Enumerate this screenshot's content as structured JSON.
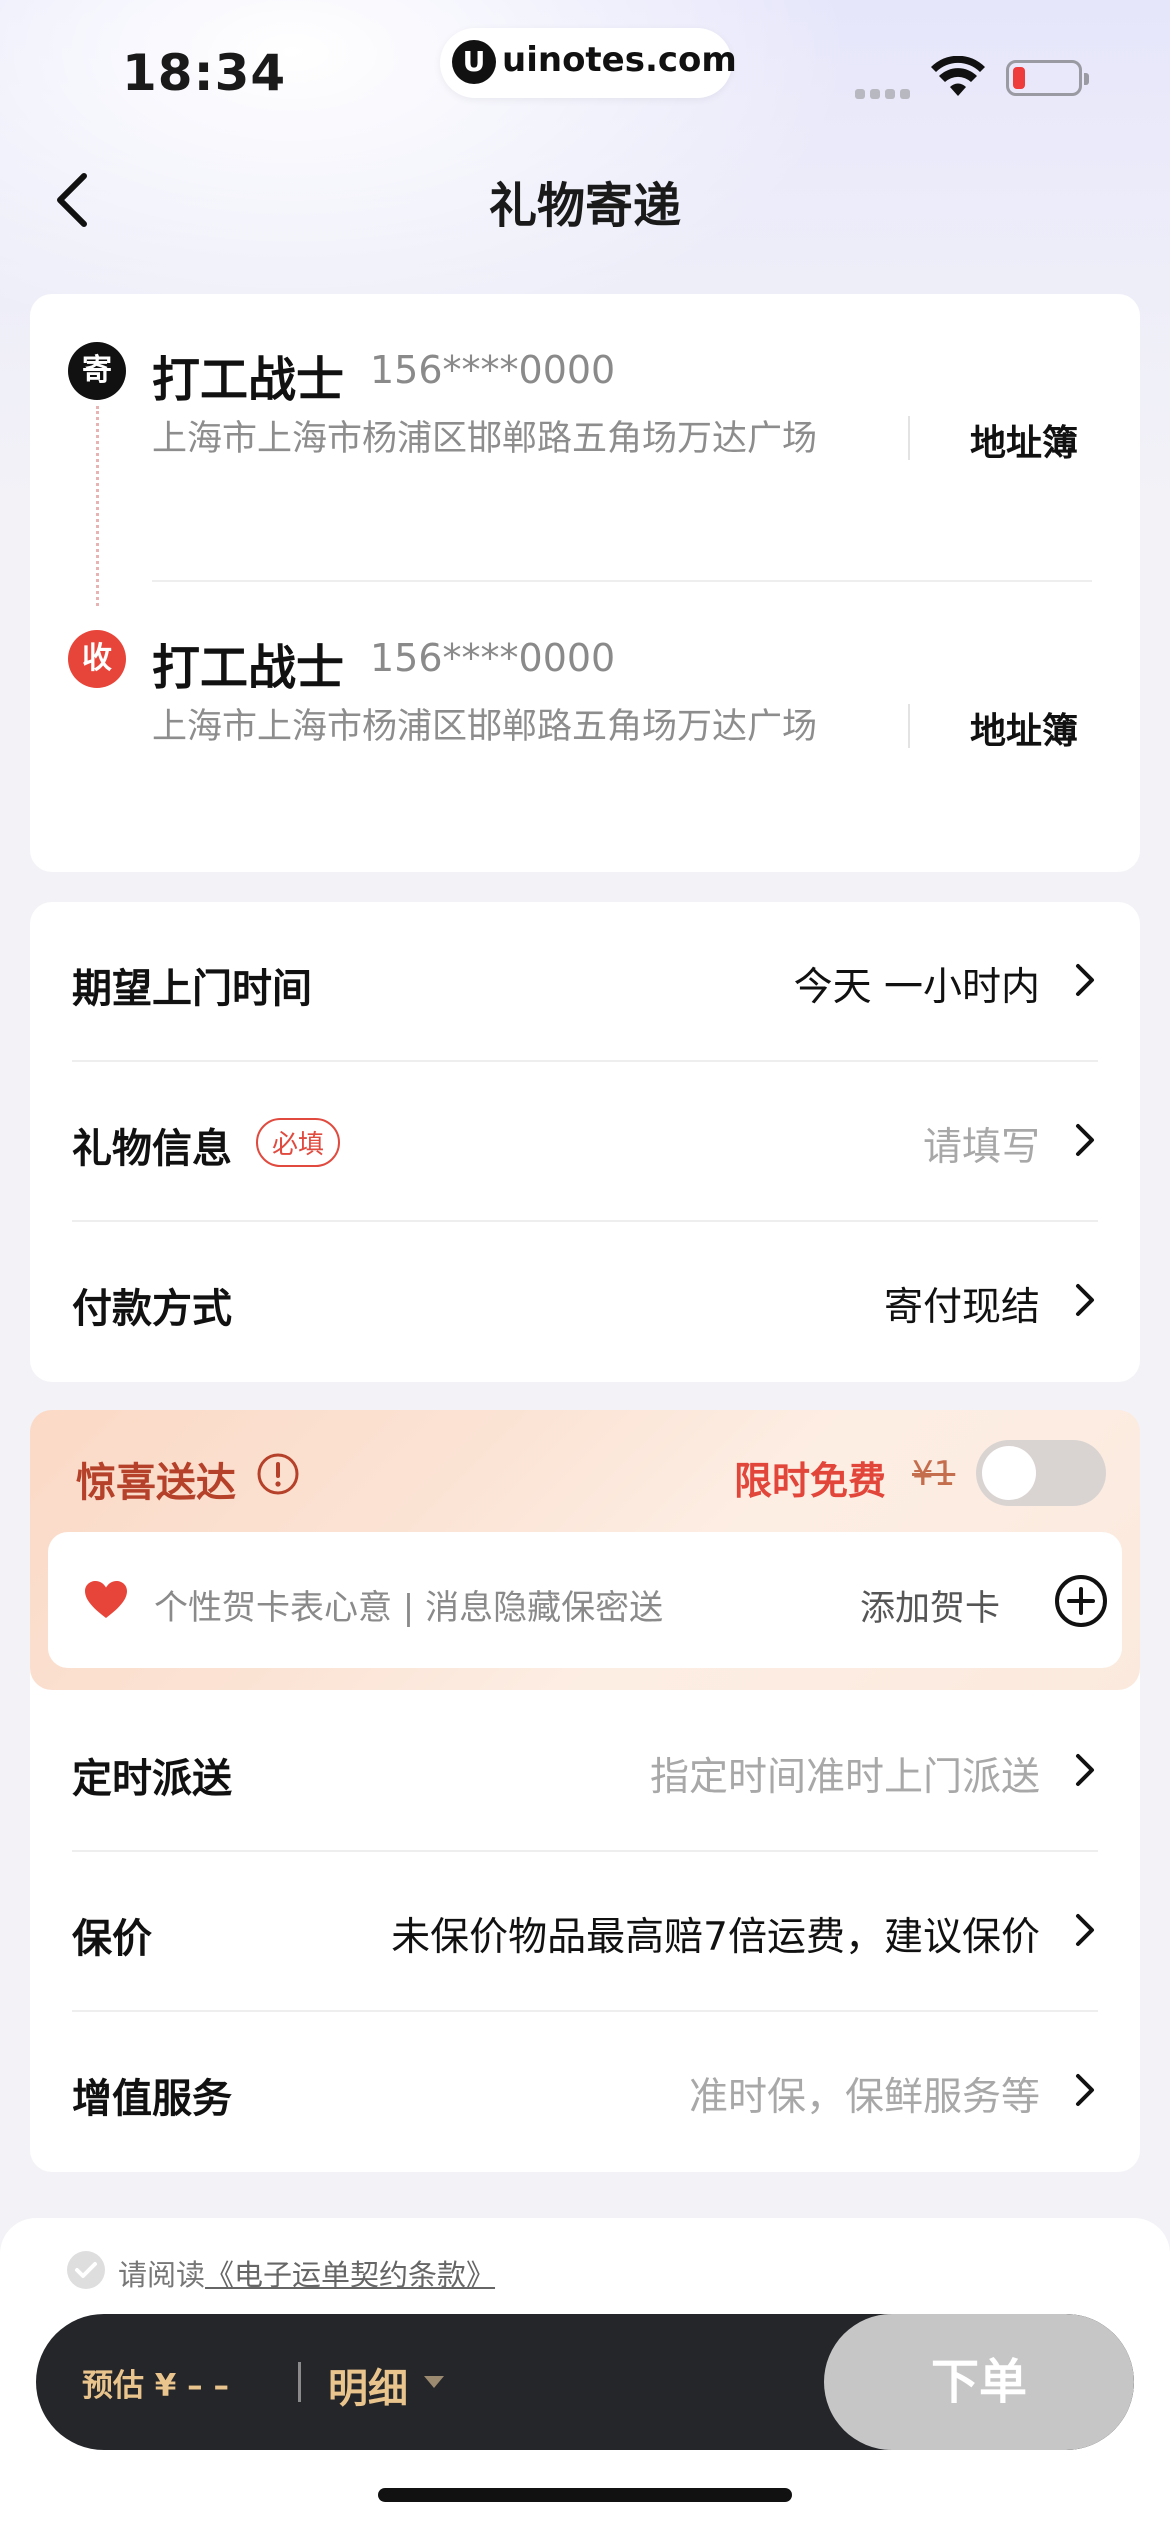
{
  "status_bar": {
    "time": "18:34",
    "site": "uinotes.com"
  },
  "header": {
    "title": "礼物寄递"
  },
  "sender": {
    "badge": "寄",
    "name": "打工战士",
    "phone": "156****0000",
    "address": "上海市上海市杨浦区邯郸路五角场万达广场",
    "book_label": "地址簿"
  },
  "receiver": {
    "badge": "收",
    "name": "打工战士",
    "phone": "156****0000",
    "address": "上海市上海市杨浦区邯郸路五角场万达广场",
    "book_label": "地址簿"
  },
  "options": [
    {
      "label": "期望上门时间",
      "value": "今天 一小时内"
    },
    {
      "label": "礼物信息",
      "required_badge": "必填",
      "value": "请填写"
    },
    {
      "label": "付款方式",
      "value": "寄付现结"
    }
  ],
  "surprise": {
    "title": "惊喜送达",
    "promo": "限时免费",
    "original_price": "¥1",
    "toggle_on": false,
    "greeting_text": "个性贺卡表心意 | 消息隐藏保密送",
    "add_card_label": "添加贺卡"
  },
  "services": [
    {
      "label": "定时派送",
      "value": "指定时间准时上门派送"
    },
    {
      "label": "保价",
      "value": "未保价物品最高赔7倍运费，建议保价"
    },
    {
      "label": "增值服务",
      "value": "准时保，保鲜服务等"
    }
  ],
  "footer": {
    "agree_prefix": "请阅读",
    "agree_link": "《电子运单契约条款》",
    "estimate_label": "预估 ¥ – –",
    "detail_label": "明细",
    "order_button": "下单"
  },
  "colors": {
    "sender_badge": "#111111",
    "receiver_badge": "#e8453a",
    "promo_red": "#e2453a",
    "bar_dark": "#25262a",
    "gold": "#e9c48c"
  }
}
